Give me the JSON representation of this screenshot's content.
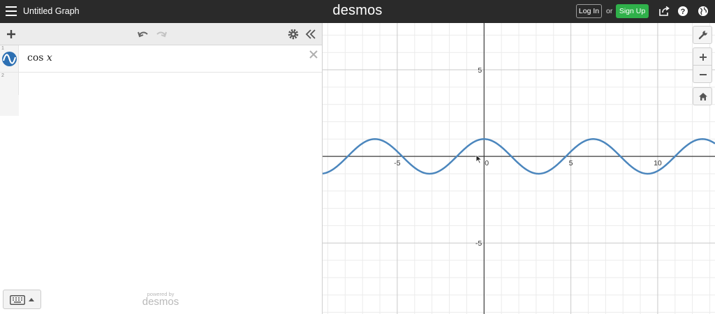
{
  "header": {
    "title": "Untitled Graph",
    "brand": "desmos",
    "login_label": "Log In",
    "or_text": "or",
    "signup_label": "Sign Up",
    "bar_color": "#2a2a2a",
    "signup_color": "#2fb04a"
  },
  "expressions": [
    {
      "index": "1",
      "latex_fn": "cos",
      "latex_var": "x",
      "color": "#2d70b3"
    },
    {
      "index": "2",
      "latex_fn": "",
      "latex_var": ""
    }
  ],
  "footer": {
    "powered_by": "powered by",
    "brand": "desmos"
  },
  "graph": {
    "x_ticks": [
      "-5",
      "0",
      "5",
      "10"
    ],
    "y_ticks": [
      "5",
      "-5"
    ],
    "function": "cos x",
    "curve_color": "#4b86bd"
  },
  "chart_data": {
    "type": "line",
    "title": "",
    "xlabel": "",
    "ylabel": "",
    "xlim": [
      -9.3,
      13.3
    ],
    "ylim": [
      -9.1,
      7.7
    ],
    "grid": true,
    "series": [
      {
        "name": "cos x",
        "expr": "cos(x)",
        "color": "#4b86bd"
      }
    ],
    "x_tick_labels": [
      "-5",
      "0",
      "5",
      "10"
    ],
    "y_tick_labels": [
      "5",
      "-5"
    ]
  }
}
